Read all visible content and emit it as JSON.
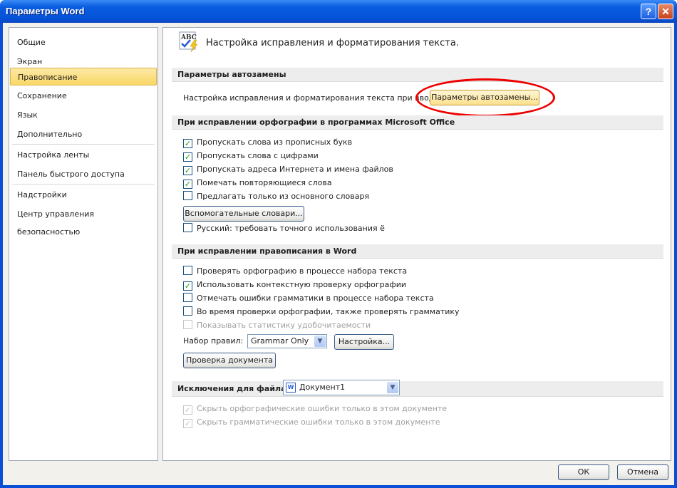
{
  "window": {
    "title": "Параметры Word",
    "help": "?",
    "close": "✕"
  },
  "sidebar": {
    "items": [
      {
        "label": "Общие"
      },
      {
        "label": "Экран"
      },
      {
        "label": "Правописание"
      },
      {
        "label": "Сохранение"
      },
      {
        "label": "Язык"
      },
      {
        "label": "Дополнительно"
      },
      {
        "label": "Настройка ленты"
      },
      {
        "label": "Панель быстрого доступа"
      },
      {
        "label": "Надстройки"
      },
      {
        "label": "Центр управления безопасностью"
      }
    ],
    "selected": "Правописание"
  },
  "main": {
    "heading": "Настройка исправления и форматирования текста.",
    "autocorrect": {
      "header": "Параметры автозамены",
      "label": "Настройка исправления и форматирования текста при вводе:",
      "button": "Параметры автозамены..."
    },
    "office": {
      "header": "При исправлении орфографии в программах Microsoft Office",
      "options": [
        {
          "label": "Пропускать слова из прописных букв",
          "checked": true
        },
        {
          "label": "Пропускать слова с цифрами",
          "checked": true
        },
        {
          "label": "Пропускать адреса Интернета и имена файлов",
          "checked": true
        },
        {
          "label": "Помечать повторяющиеся слова",
          "checked": true
        },
        {
          "label": "Предлагать только из основного словаря",
          "checked": false
        }
      ],
      "dict_button": "Вспомогательные словари...",
      "russian": {
        "label": "Русский: требовать точного использования ё",
        "checked": false
      }
    },
    "word": {
      "header": "При исправлении правописания в Word",
      "options": [
        {
          "label": "Проверять орфографию в процессе набора текста",
          "checked": false
        },
        {
          "label": "Использовать контекстную проверку орфографии",
          "checked": true
        },
        {
          "label": "Отмечать ошибки грамматики в процессе набора текста",
          "checked": false
        },
        {
          "label": "Во время проверки орфографии, также проверять грамматику",
          "checked": false
        },
        {
          "label": "Показывать статистику удобочитаемости",
          "checked": false,
          "disabled": true
        }
      ],
      "ruleset_label": "Набор правил:",
      "ruleset_value": "Grammar Only",
      "settings_button": "Настройка...",
      "check_button": "Проверка документа"
    },
    "exceptions": {
      "header": "Исключения для файла:",
      "file": "Документ1",
      "options": [
        {
          "label": "Скрыть орфографические ошибки только в этом документе",
          "checked": true,
          "disabled": true
        },
        {
          "label": "Скрыть грамматические ошибки только в этом документе",
          "checked": true,
          "disabled": true
        }
      ]
    }
  },
  "footer": {
    "ok": "ОК",
    "cancel": "Отмена"
  },
  "colors": {
    "highlight": "#f9d766",
    "title_bar": "#0453d8",
    "annotation": "#ee0000"
  }
}
